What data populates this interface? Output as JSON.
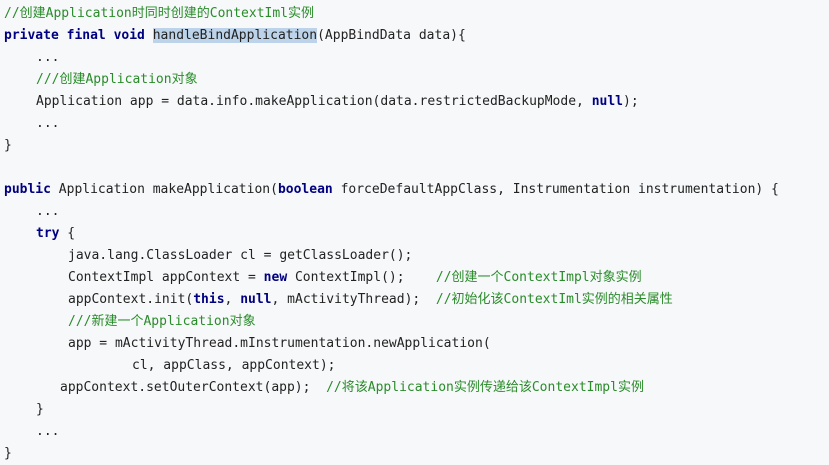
{
  "colors": {
    "background": "#f6f8fa",
    "keyword": "#000080",
    "comment": "#2a8c2a",
    "text": "#222222",
    "selection": "#bcd3ea"
  },
  "code_lines": [
    {
      "indent": 0,
      "tokens": [
        {
          "t": "c",
          "v": "//创建Application时同时创建的ContextIml实例"
        }
      ]
    },
    {
      "indent": 0,
      "tokens": [
        {
          "t": "k",
          "v": "private final void "
        },
        {
          "t": "hl",
          "v": "handleBindApplication"
        },
        {
          "t": "p",
          "v": "(AppBindData data){"
        }
      ]
    },
    {
      "indent": 4,
      "tokens": [
        {
          "t": "p",
          "v": "..."
        }
      ]
    },
    {
      "indent": 4,
      "tokens": [
        {
          "t": "c",
          "v": "///创建Application对象"
        }
      ]
    },
    {
      "indent": 4,
      "tokens": [
        {
          "t": "p",
          "v": "Application app = data.info.makeApplication(data.restrictedBackupMode, "
        },
        {
          "t": "k",
          "v": "null"
        },
        {
          "t": "p",
          "v": ");"
        }
      ]
    },
    {
      "indent": 4,
      "tokens": [
        {
          "t": "p",
          "v": "..."
        }
      ]
    },
    {
      "indent": 0,
      "tokens": [
        {
          "t": "p",
          "v": "}"
        }
      ]
    },
    {
      "indent": 0,
      "tokens": []
    },
    {
      "indent": 0,
      "tokens": [
        {
          "t": "k",
          "v": "public "
        },
        {
          "t": "p",
          "v": "Application makeApplication("
        },
        {
          "t": "k",
          "v": "boolean"
        },
        {
          "t": "p",
          "v": " forceDefaultAppClass, Instrumentation instrumentation) {"
        }
      ]
    },
    {
      "indent": 4,
      "tokens": [
        {
          "t": "p",
          "v": "..."
        }
      ]
    },
    {
      "indent": 4,
      "tokens": [
        {
          "t": "k",
          "v": "try"
        },
        {
          "t": "p",
          "v": " {"
        }
      ]
    },
    {
      "indent": 8,
      "tokens": [
        {
          "t": "p",
          "v": "java.lang.ClassLoader cl = getClassLoader();"
        }
      ]
    },
    {
      "indent": 8,
      "tokens": [
        {
          "t": "p",
          "v": "ContextImpl appContext = "
        },
        {
          "t": "k",
          "v": "new"
        },
        {
          "t": "p",
          "v": " ContextImpl();    "
        },
        {
          "t": "c",
          "v": "//创建一个ContextImpl对象实例"
        }
      ]
    },
    {
      "indent": 8,
      "tokens": [
        {
          "t": "p",
          "v": "appContext.init("
        },
        {
          "t": "k",
          "v": "this"
        },
        {
          "t": "p",
          "v": ", "
        },
        {
          "t": "k",
          "v": "null"
        },
        {
          "t": "p",
          "v": ", mActivityThread);  "
        },
        {
          "t": "c",
          "v": "//初始化该ContextIml实例的相关属性"
        }
      ]
    },
    {
      "indent": 8,
      "tokens": [
        {
          "t": "c",
          "v": "///新建一个Application对象"
        }
      ]
    },
    {
      "indent": 8,
      "tokens": [
        {
          "t": "p",
          "v": "app = mActivityThread.mInstrumentation.newApplication("
        }
      ]
    },
    {
      "indent": 16,
      "tokens": [
        {
          "t": "p",
          "v": "cl, appClass, appContext);"
        }
      ]
    },
    {
      "indent": 7,
      "tokens": [
        {
          "t": "p",
          "v": "appContext.setOuterContext(app);  "
        },
        {
          "t": "c",
          "v": "//将该Application实例传递给该ContextImpl实例"
        }
      ]
    },
    {
      "indent": 4,
      "tokens": [
        {
          "t": "p",
          "v": "}"
        }
      ]
    },
    {
      "indent": 4,
      "tokens": [
        {
          "t": "p",
          "v": "..."
        }
      ]
    },
    {
      "indent": 0,
      "tokens": [
        {
          "t": "p",
          "v": "}"
        }
      ]
    }
  ]
}
